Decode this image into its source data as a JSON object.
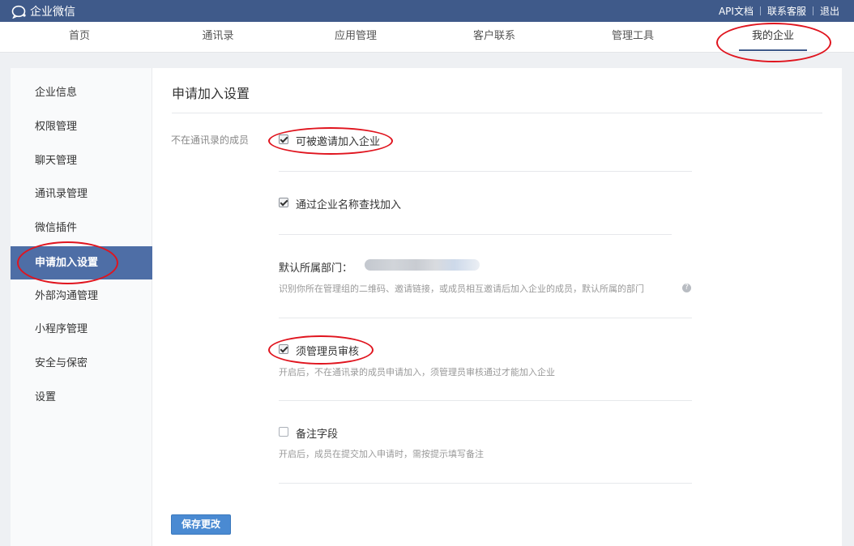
{
  "topbar": {
    "brand": "企业微信",
    "links": [
      "API文档",
      "联系客服",
      "退出"
    ]
  },
  "nav": {
    "items": [
      "首页",
      "通讯录",
      "应用管理",
      "客户联系",
      "管理工具",
      "我的企业"
    ],
    "active": "我的企业"
  },
  "sidebar": {
    "items": [
      "企业信息",
      "权限管理",
      "聊天管理",
      "通讯录管理",
      "微信插件",
      "申请加入设置",
      "外部沟通管理",
      "小程序管理",
      "安全与保密",
      "设置"
    ],
    "active": "申请加入设置"
  },
  "main": {
    "title": "申请加入设置",
    "row_label": "不在通讯录的成员",
    "options": [
      {
        "label": "可被邀请加入企业",
        "checked": true
      },
      {
        "label": "通过企业名称查找加入",
        "checked": true
      },
      {
        "label": "须管理员审核",
        "checked": true,
        "desc": "开启后，不在通讯录的成员申请加入，须管理员审核通过才能加入企业"
      },
      {
        "label": "备注字段",
        "checked": false,
        "desc": "开启后，成员在提交加入申请时，需按提示填写备注"
      }
    ],
    "default_dept": {
      "label": "默认所属部门：",
      "desc": "识别你所在管理组的二维码、邀请链接，或成员相互邀请后加入企业的成员，默认所属的部门",
      "help_icon": "?"
    },
    "save_label": "保存更改"
  },
  "annotation": {
    "color": "#e0141e"
  }
}
